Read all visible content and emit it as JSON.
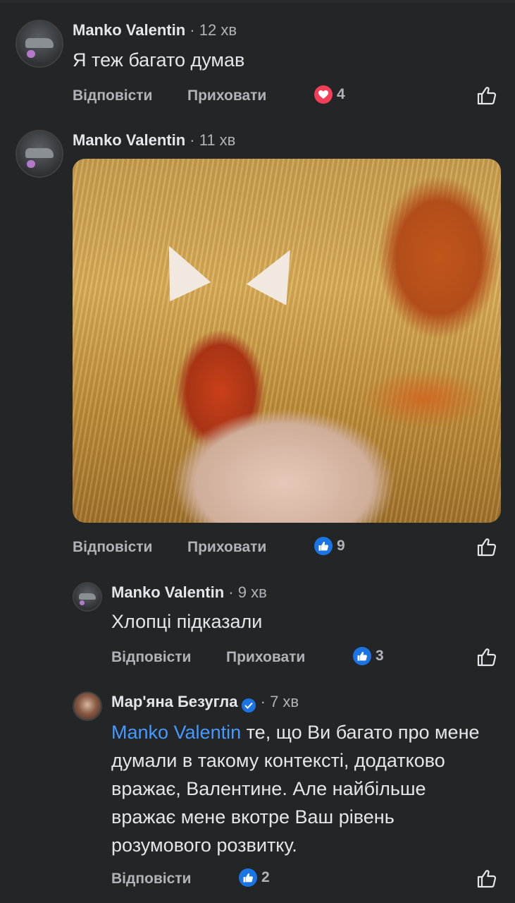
{
  "comments": [
    {
      "author": "Manko Valentin",
      "time": "12 хв",
      "text": "Я теж багато думав",
      "reply_label": "Відповісти",
      "hide_label": "Приховати",
      "reaction_icon": "love-icon",
      "reaction_count": "4"
    },
    {
      "author": "Manko Valentin",
      "time": "11 хв",
      "image_description_icon": "photo",
      "reply_label": "Відповісти",
      "hide_label": "Приховати",
      "reaction_icon": "like-icon",
      "reaction_count": "9"
    },
    {
      "author": "Manko Valentin",
      "time": "9 хв",
      "text": "Хлопці підказали",
      "reply_label": "Відповісти",
      "hide_label": "Приховати",
      "reaction_icon": "like-icon",
      "reaction_count": "3"
    },
    {
      "author": "Мар'яна Безугла",
      "verified": true,
      "time": "7 хв",
      "mention": "Manko Valentin",
      "text": " те, що Ви багато про мене думали в такому контексті, додатково вражає, Валентине. Але найбільше вражає мене вкотре Ваш рівень розумового розвитку.",
      "reply_label": "Відповісти",
      "reaction_icon": "like-icon",
      "reaction_count": "2"
    }
  ],
  "separator": "·",
  "colors": {
    "background": "#242526",
    "text_primary": "#e4e6eb",
    "text_secondary": "#b0b3b8",
    "like_blue": "#1b74e4",
    "love_red": "#f33e58",
    "mention_blue": "#4599ff"
  }
}
